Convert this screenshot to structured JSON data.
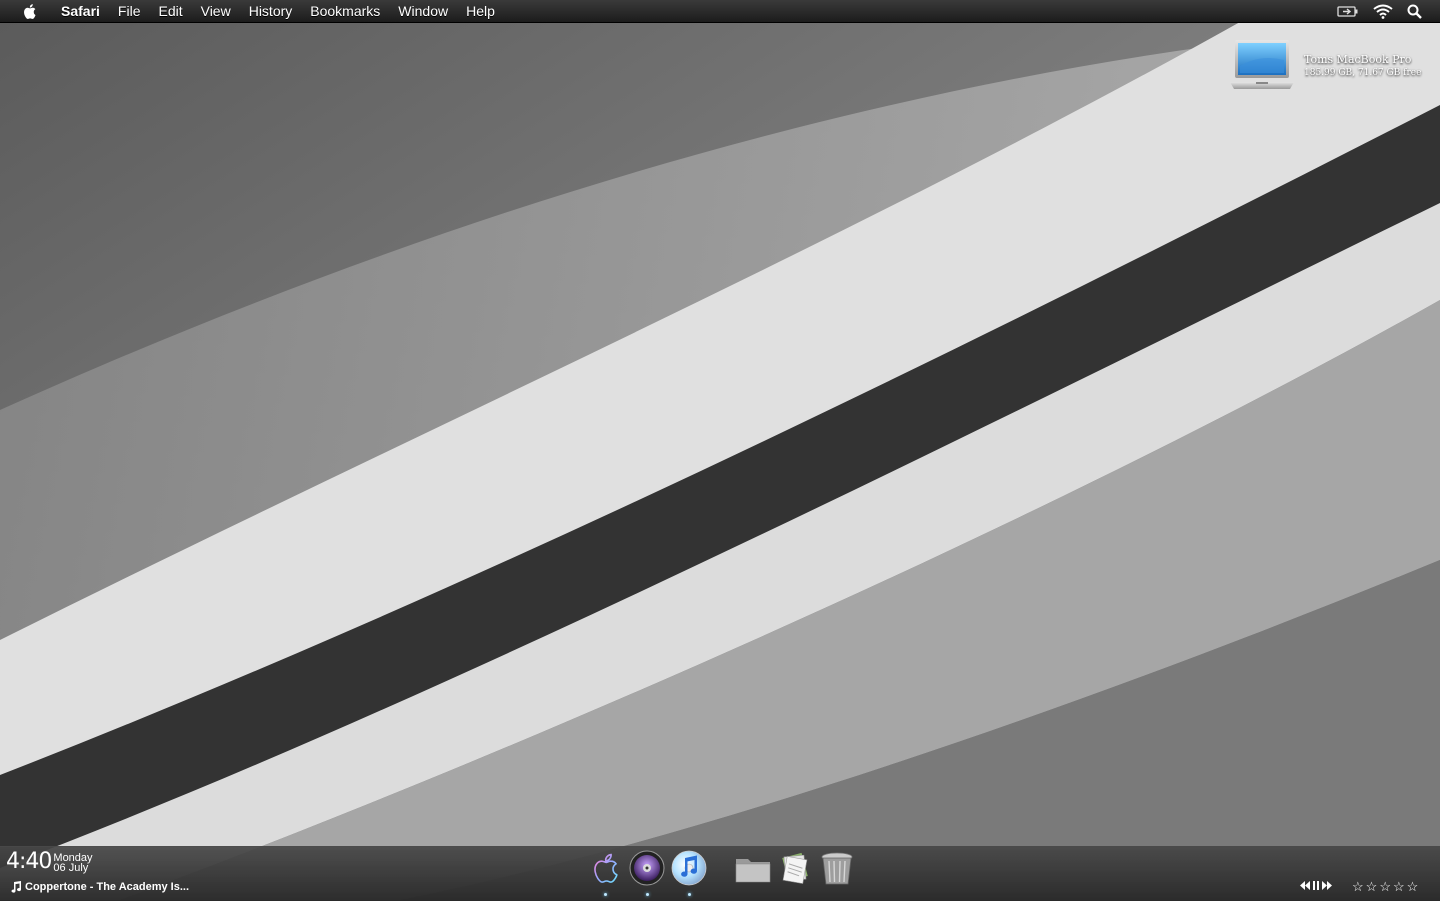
{
  "menubar": {
    "app_name": "Safari",
    "items": [
      "File",
      "Edit",
      "View",
      "History",
      "Bookmarks",
      "Window",
      "Help"
    ]
  },
  "desktop": {
    "drive": {
      "name": "Toms MacBook Pro",
      "info": "185.99 GB, 71.67 GB free"
    }
  },
  "widgets": {
    "clock": {
      "time": "4:40",
      "day": "Monday",
      "date": "06 July"
    },
    "now_playing": {
      "track": "Coppertone - The Academy Is..."
    },
    "rating": {
      "stars": 0,
      "max": 5
    }
  },
  "dock": {
    "items": [
      {
        "name": "apple-icon",
        "running": true
      },
      {
        "name": "dvd-player-icon",
        "running": true
      },
      {
        "name": "itunes-icon",
        "running": true
      },
      {
        "name": "folder-icon",
        "running": false
      },
      {
        "name": "documents-stack-icon",
        "running": false
      },
      {
        "name": "trash-icon",
        "running": false
      }
    ]
  },
  "colors": {
    "menubar": "#2a2a2a",
    "band_dark": "#333333",
    "band_light": "#e0e0e0"
  }
}
